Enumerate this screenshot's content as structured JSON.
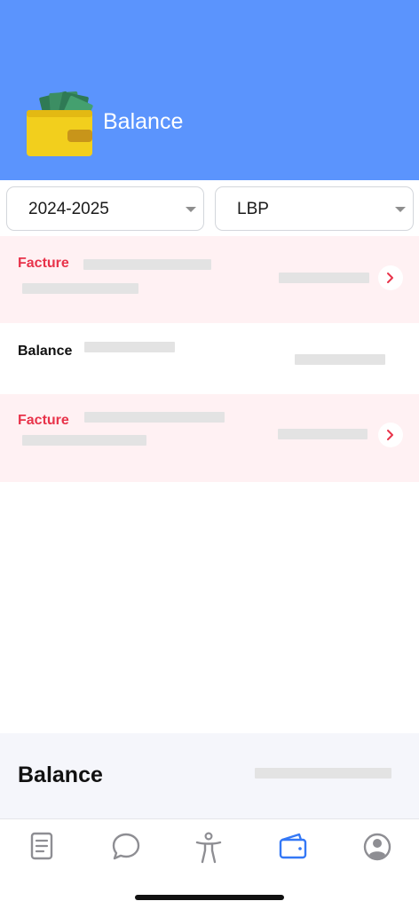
{
  "header": {
    "title": "Balance",
    "icon": "wallet-money-icon",
    "background_color": "#5b94fd"
  },
  "filters": {
    "year": {
      "selected": "2024-2025"
    },
    "currency": {
      "selected": "LBP"
    }
  },
  "rows": [
    {
      "type": "invoice",
      "label": "Facture"
    },
    {
      "type": "balance",
      "label": "Balance"
    },
    {
      "type": "invoice",
      "label": "Facture"
    }
  ],
  "summary": {
    "label": "Balance"
  },
  "tabbar": {
    "tabs": [
      {
        "icon": "document-icon",
        "active": false
      },
      {
        "icon": "chat-bubble-icon",
        "active": false
      },
      {
        "icon": "person-icon",
        "active": false
      },
      {
        "icon": "wallet-icon",
        "active": true
      },
      {
        "icon": "profile-icon",
        "active": false
      }
    ],
    "active_color": "#3478f6",
    "inactive_color": "#8e8e93"
  },
  "colors": {
    "invoice_label": "#e8334a",
    "invoice_row_bg": "#fff1f3",
    "skeleton": "#e3e3e3"
  }
}
